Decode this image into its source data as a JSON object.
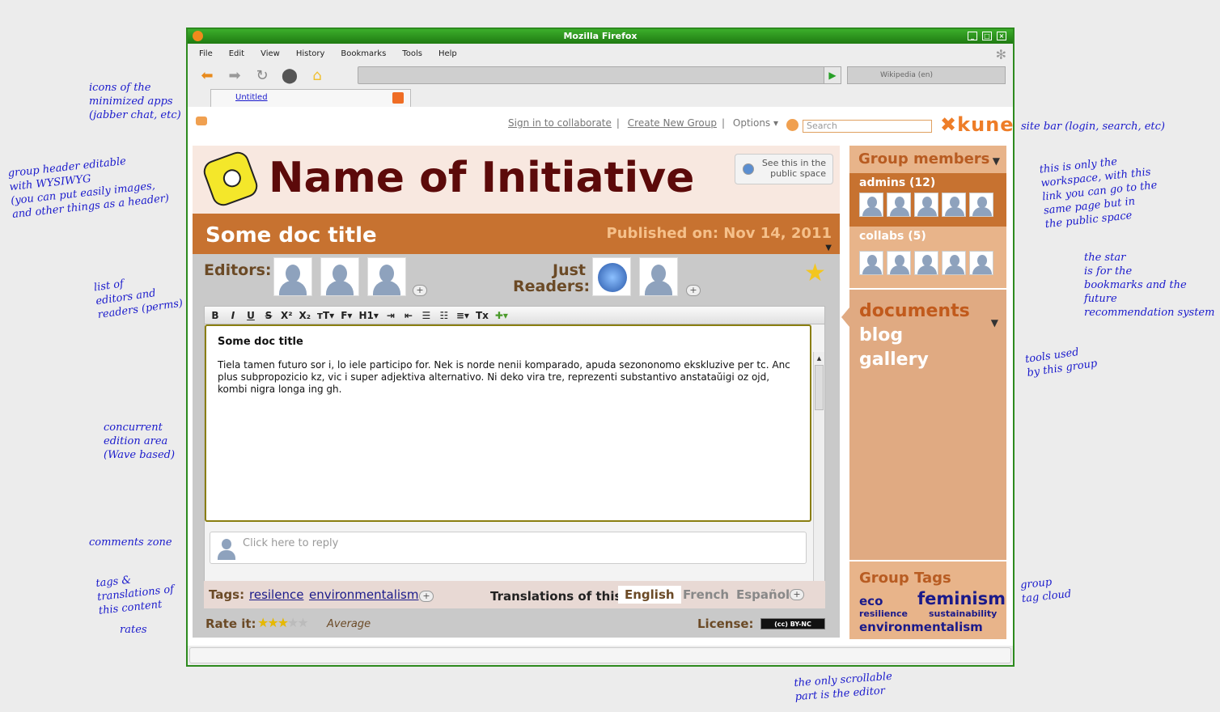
{
  "window": {
    "title": "Mozilla Firefox"
  },
  "menu": [
    "File",
    "Edit",
    "View",
    "History",
    "Bookmarks",
    "Tools",
    "Help"
  ],
  "browser": {
    "search_placeholder": "Wikipedia (en)",
    "tab_label": "Untitled"
  },
  "sitebar": {
    "signin": "Sign in to collaborate",
    "new_group": "Create New Group",
    "options": "Options ▾",
    "search_placeholder": "Search",
    "logo": "kune"
  },
  "group": {
    "name": "Name of Initiative",
    "public_link": "See this in the public space"
  },
  "doc": {
    "title": "Some doc title",
    "published": "Published on: Nov 14, 2011",
    "editors_label": "Editors:",
    "readers_label": "Just Readers:",
    "body_title": "Some doc title",
    "body": "Tiela tamen futuro sor i, lo iele participo for. Nek is norde nenii komparado, apuda sezononomo ekskluzive per tc. Anc plus subpropozicio kz, vic i super adjektiva alternativo. Ni deko vira tre, reprezenti substantivo anstataŭigi oz ojd, kombi nigra longa ing gh.",
    "reply_placeholder": "Click here to reply"
  },
  "toolbar": [
    "B",
    "I",
    "U",
    "S",
    "X²",
    "X₂",
    "тT▾",
    "F▾",
    "H1▾",
    "⇥",
    "⇤",
    "☰",
    "☷",
    "≡▾",
    "Tx",
    "✚▾"
  ],
  "tags": {
    "label": "Tags:",
    "items": [
      "resilence",
      "environmentalism"
    ]
  },
  "translations": {
    "label": "Translations of this:",
    "langs": [
      "English",
      "French",
      "Español"
    ]
  },
  "rating": {
    "label": "Rate it:",
    "value": 3,
    "max": 5,
    "text": "Average"
  },
  "license": {
    "label": "License:",
    "badge": "(cc) BY-NC"
  },
  "members": {
    "title": "Group members",
    "admins_label": "admins (12)",
    "collabs_label": "collabs (5)"
  },
  "tools": [
    "documents",
    "blog",
    "gallery"
  ],
  "group_tags": {
    "title": "Group Tags",
    "tags": [
      "eco",
      "feminism",
      "resilience",
      "sustainability",
      "environmentalism"
    ]
  },
  "annotations": {
    "a1": "icons of the\nminimized apps\n(jabber chat, etc)",
    "a2": "group header editable\nwith WYSIWYG\n(you can put easily images,\nand other things as a header)",
    "a3": "list of\neditors and\nreaders (perms)",
    "a4": "concurrent\nedition area\n(Wave based)",
    "a5": "comments zone",
    "a6": "tags &\ntranslations of\nthis content",
    "a7": "rates",
    "a8": "site bar (login, search, etc)",
    "a9": "this is only the\nworkspace, with this\nlink you can go to the\nsame page but in\nthe public space",
    "a10": "the star\nis for the\nbookmarks and the\nfuture\nrecommendation system",
    "a11": "tools used\nby this group",
    "a12": "group\ntag cloud",
    "a13": "the only scrollable\npart is the editor"
  }
}
